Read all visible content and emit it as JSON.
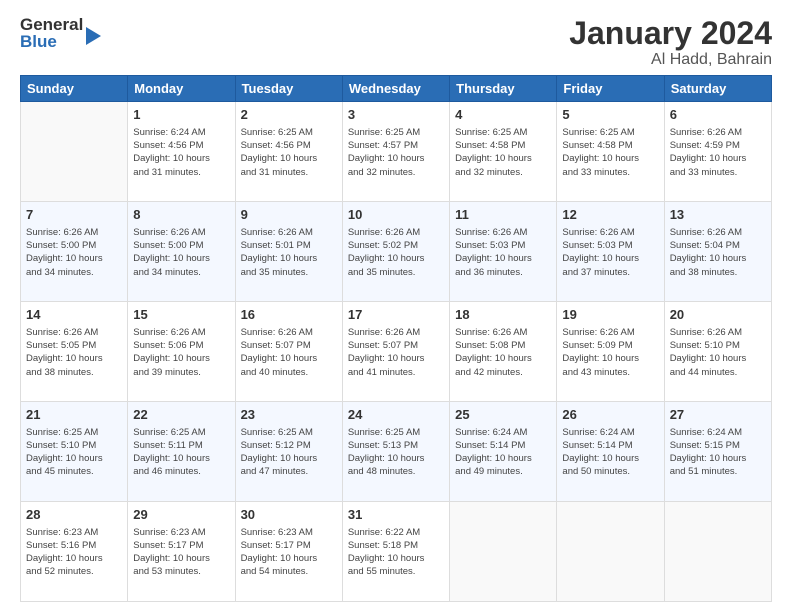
{
  "header": {
    "logo_general": "General",
    "logo_blue": "Blue",
    "title": "January 2024",
    "subtitle": "Al Hadd, Bahrain"
  },
  "days": [
    "Sunday",
    "Monday",
    "Tuesday",
    "Wednesday",
    "Thursday",
    "Friday",
    "Saturday"
  ],
  "weeks": [
    [
      {
        "day": "",
        "sunrise": "",
        "sunset": "",
        "daylight": ""
      },
      {
        "day": "1",
        "sunrise": "Sunrise: 6:24 AM",
        "sunset": "Sunset: 4:56 PM",
        "daylight": "Daylight: 10 hours and 31 minutes."
      },
      {
        "day": "2",
        "sunrise": "Sunrise: 6:25 AM",
        "sunset": "Sunset: 4:56 PM",
        "daylight": "Daylight: 10 hours and 31 minutes."
      },
      {
        "day": "3",
        "sunrise": "Sunrise: 6:25 AM",
        "sunset": "Sunset: 4:57 PM",
        "daylight": "Daylight: 10 hours and 32 minutes."
      },
      {
        "day": "4",
        "sunrise": "Sunrise: 6:25 AM",
        "sunset": "Sunset: 4:58 PM",
        "daylight": "Daylight: 10 hours and 32 minutes."
      },
      {
        "day": "5",
        "sunrise": "Sunrise: 6:25 AM",
        "sunset": "Sunset: 4:58 PM",
        "daylight": "Daylight: 10 hours and 33 minutes."
      },
      {
        "day": "6",
        "sunrise": "Sunrise: 6:26 AM",
        "sunset": "Sunset: 4:59 PM",
        "daylight": "Daylight: 10 hours and 33 minutes."
      }
    ],
    [
      {
        "day": "7",
        "sunrise": "Sunrise: 6:26 AM",
        "sunset": "Sunset: 5:00 PM",
        "daylight": "Daylight: 10 hours and 34 minutes."
      },
      {
        "day": "8",
        "sunrise": "Sunrise: 6:26 AM",
        "sunset": "Sunset: 5:00 PM",
        "daylight": "Daylight: 10 hours and 34 minutes."
      },
      {
        "day": "9",
        "sunrise": "Sunrise: 6:26 AM",
        "sunset": "Sunset: 5:01 PM",
        "daylight": "Daylight: 10 hours and 35 minutes."
      },
      {
        "day": "10",
        "sunrise": "Sunrise: 6:26 AM",
        "sunset": "Sunset: 5:02 PM",
        "daylight": "Daylight: 10 hours and 35 minutes."
      },
      {
        "day": "11",
        "sunrise": "Sunrise: 6:26 AM",
        "sunset": "Sunset: 5:03 PM",
        "daylight": "Daylight: 10 hours and 36 minutes."
      },
      {
        "day": "12",
        "sunrise": "Sunrise: 6:26 AM",
        "sunset": "Sunset: 5:03 PM",
        "daylight": "Daylight: 10 hours and 37 minutes."
      },
      {
        "day": "13",
        "sunrise": "Sunrise: 6:26 AM",
        "sunset": "Sunset: 5:04 PM",
        "daylight": "Daylight: 10 hours and 38 minutes."
      }
    ],
    [
      {
        "day": "14",
        "sunrise": "Sunrise: 6:26 AM",
        "sunset": "Sunset: 5:05 PM",
        "daylight": "Daylight: 10 hours and 38 minutes."
      },
      {
        "day": "15",
        "sunrise": "Sunrise: 6:26 AM",
        "sunset": "Sunset: 5:06 PM",
        "daylight": "Daylight: 10 hours and 39 minutes."
      },
      {
        "day": "16",
        "sunrise": "Sunrise: 6:26 AM",
        "sunset": "Sunset: 5:07 PM",
        "daylight": "Daylight: 10 hours and 40 minutes."
      },
      {
        "day": "17",
        "sunrise": "Sunrise: 6:26 AM",
        "sunset": "Sunset: 5:07 PM",
        "daylight": "Daylight: 10 hours and 41 minutes."
      },
      {
        "day": "18",
        "sunrise": "Sunrise: 6:26 AM",
        "sunset": "Sunset: 5:08 PM",
        "daylight": "Daylight: 10 hours and 42 minutes."
      },
      {
        "day": "19",
        "sunrise": "Sunrise: 6:26 AM",
        "sunset": "Sunset: 5:09 PM",
        "daylight": "Daylight: 10 hours and 43 minutes."
      },
      {
        "day": "20",
        "sunrise": "Sunrise: 6:26 AM",
        "sunset": "Sunset: 5:10 PM",
        "daylight": "Daylight: 10 hours and 44 minutes."
      }
    ],
    [
      {
        "day": "21",
        "sunrise": "Sunrise: 6:25 AM",
        "sunset": "Sunset: 5:10 PM",
        "daylight": "Daylight: 10 hours and 45 minutes."
      },
      {
        "day": "22",
        "sunrise": "Sunrise: 6:25 AM",
        "sunset": "Sunset: 5:11 PM",
        "daylight": "Daylight: 10 hours and 46 minutes."
      },
      {
        "day": "23",
        "sunrise": "Sunrise: 6:25 AM",
        "sunset": "Sunset: 5:12 PM",
        "daylight": "Daylight: 10 hours and 47 minutes."
      },
      {
        "day": "24",
        "sunrise": "Sunrise: 6:25 AM",
        "sunset": "Sunset: 5:13 PM",
        "daylight": "Daylight: 10 hours and 48 minutes."
      },
      {
        "day": "25",
        "sunrise": "Sunrise: 6:24 AM",
        "sunset": "Sunset: 5:14 PM",
        "daylight": "Daylight: 10 hours and 49 minutes."
      },
      {
        "day": "26",
        "sunrise": "Sunrise: 6:24 AM",
        "sunset": "Sunset: 5:14 PM",
        "daylight": "Daylight: 10 hours and 50 minutes."
      },
      {
        "day": "27",
        "sunrise": "Sunrise: 6:24 AM",
        "sunset": "Sunset: 5:15 PM",
        "daylight": "Daylight: 10 hours and 51 minutes."
      }
    ],
    [
      {
        "day": "28",
        "sunrise": "Sunrise: 6:23 AM",
        "sunset": "Sunset: 5:16 PM",
        "daylight": "Daylight: 10 hours and 52 minutes."
      },
      {
        "day": "29",
        "sunrise": "Sunrise: 6:23 AM",
        "sunset": "Sunset: 5:17 PM",
        "daylight": "Daylight: 10 hours and 53 minutes."
      },
      {
        "day": "30",
        "sunrise": "Sunrise: 6:23 AM",
        "sunset": "Sunset: 5:17 PM",
        "daylight": "Daylight: 10 hours and 54 minutes."
      },
      {
        "day": "31",
        "sunrise": "Sunrise: 6:22 AM",
        "sunset": "Sunset: 5:18 PM",
        "daylight": "Daylight: 10 hours and 55 minutes."
      },
      {
        "day": "",
        "sunrise": "",
        "sunset": "",
        "daylight": ""
      },
      {
        "day": "",
        "sunrise": "",
        "sunset": "",
        "daylight": ""
      },
      {
        "day": "",
        "sunrise": "",
        "sunset": "",
        "daylight": ""
      }
    ]
  ]
}
